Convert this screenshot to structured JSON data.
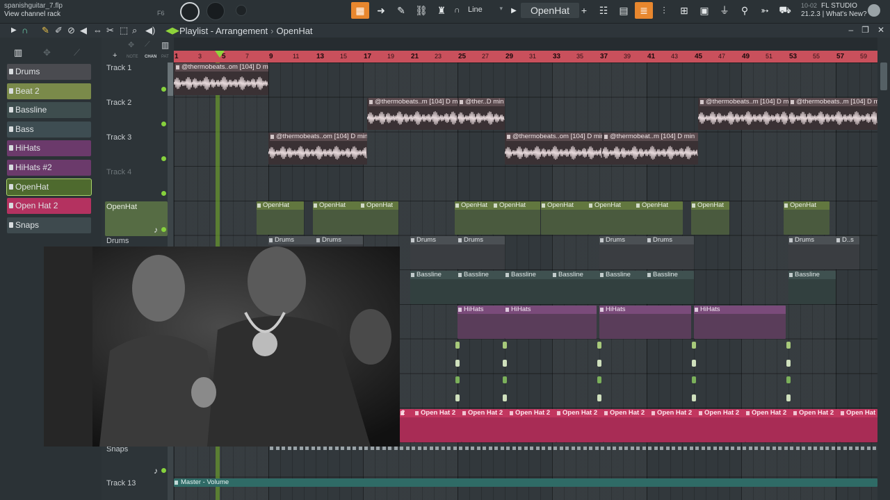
{
  "window": {
    "project_file": "spanishguitar_7.flp",
    "hint": "View channel rack",
    "hint_key": "F6",
    "clock": "10-02",
    "app_label": "FL STUDIO",
    "version_news": "21.2.3 | What's New?"
  },
  "toolbar": {
    "snap_mode": "Line",
    "pattern_name": "OpenHat",
    "add_icon": "+"
  },
  "playlist": {
    "title": "Playlist - Arrangement",
    "pattern": "OpenHat",
    "sep": "›"
  },
  "picker": {
    "items": [
      {
        "label": "Drums",
        "color": "#4a4b50"
      },
      {
        "label": "Beat 2",
        "color": "#7a8a4a"
      },
      {
        "label": "Bassline",
        "color": "#3e4d4e"
      },
      {
        "label": "Bass",
        "color": "#3e4d52"
      },
      {
        "label": "HiHats",
        "color": "#6b3a6b"
      },
      {
        "label": "HiHats #2",
        "color": "#6b3a6b"
      },
      {
        "label": "OpenHat",
        "color": "#4e6a2e"
      },
      {
        "label": "Open Hat 2",
        "color": "#b43260"
      },
      {
        "label": "Snaps",
        "color": "#3e4a4e"
      }
    ]
  },
  "track_header_bar": {
    "note": "NOTE",
    "chan": "CHAN",
    "pat": "PAT"
  },
  "tracks": [
    {
      "name": "Track 1"
    },
    {
      "name": "Track 2"
    },
    {
      "name": "Track 3"
    },
    {
      "name": "Track 4"
    },
    {
      "name": "OpenHat"
    },
    {
      "name": "Drums"
    },
    {
      "name": "Snaps"
    },
    {
      "name": "Track 13"
    }
  ],
  "ruler": {
    "bars": [
      "1",
      "3",
      "5",
      "7",
      "9",
      "11",
      "13",
      "15",
      "17",
      "19",
      "21",
      "23",
      "25",
      "27",
      "29",
      "31",
      "33",
      "35",
      "37",
      "39",
      "41",
      "43",
      "45",
      "47",
      "49",
      "51",
      "53",
      "55",
      "57",
      "59"
    ]
  },
  "clips": {
    "audio_a": "@thermobeats..om [104] D min",
    "audio_b": "@thermobeats..m [104] D min",
    "audio_c": "@ther..D min",
    "audio_d": "@thermobeat..m [104] D min",
    "openhat": "OpenHat",
    "drums": "Drums",
    "drums_short": "D..s",
    "bassline": "Bassline",
    "hihats": "HiHats",
    "openhat2": "Open Hat 2",
    "openhat2_frag": "2",
    "automation": "Master - Volume"
  },
  "colors": {
    "ruler": "#c9505c",
    "accent": "#e8872e",
    "playhead": "#8fd43b"
  }
}
